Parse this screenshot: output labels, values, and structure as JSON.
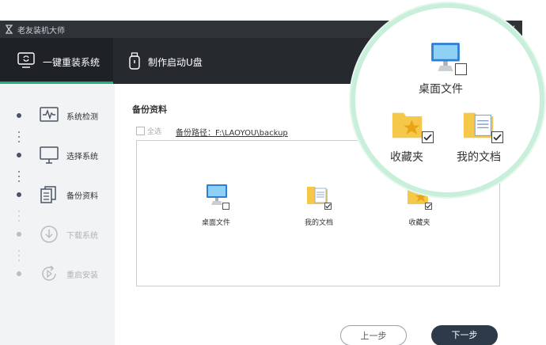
{
  "window": {
    "app_title": "老友装机大师",
    "min_symbol": "—",
    "close_symbol": "✕"
  },
  "tabs": [
    {
      "label": "一键重装系统",
      "icon": "refresh-monitor-icon"
    },
    {
      "label": "制作启动U盘",
      "icon": "usb-drive-icon"
    }
  ],
  "sidebar": {
    "steps": [
      {
        "label": "系统检测",
        "icon": "pulse-monitor-icon",
        "state": "done"
      },
      {
        "label": "选择系统",
        "icon": "monitor-icon",
        "state": "done"
      },
      {
        "label": "备份资料",
        "icon": "documents-icon",
        "state": "active"
      },
      {
        "label": "下载系统",
        "icon": "download-circle-icon",
        "state": "pending"
      },
      {
        "label": "重启安装",
        "icon": "restart-icon",
        "state": "pending"
      }
    ]
  },
  "main": {
    "section_title": "备份资料",
    "select_all_label": "全选",
    "backup_path": "备份路径：F:\\LAOYOU\\backup",
    "files": [
      {
        "label": "桌面文件",
        "icon": "desktop-computer-icon",
        "checked": false
      },
      {
        "label": "我的文档",
        "icon": "documents-folder-icon",
        "checked": true
      },
      {
        "label": "收藏夹",
        "icon": "favorites-folder-icon",
        "checked": true
      }
    ],
    "prev_button": "上一步",
    "next_button": "下一步"
  },
  "zoom_callout": {
    "items": [
      {
        "label": "桌面文件",
        "checked": false
      },
      {
        "label": "收藏夹",
        "checked": true
      },
      {
        "label": "我的文档",
        "checked": true
      }
    ]
  },
  "colors": {
    "accent_green": "#21b07a",
    "dark_bg": "#262a2e",
    "next_button": "#2c3a49",
    "callout_ring": "#c8efd9"
  }
}
